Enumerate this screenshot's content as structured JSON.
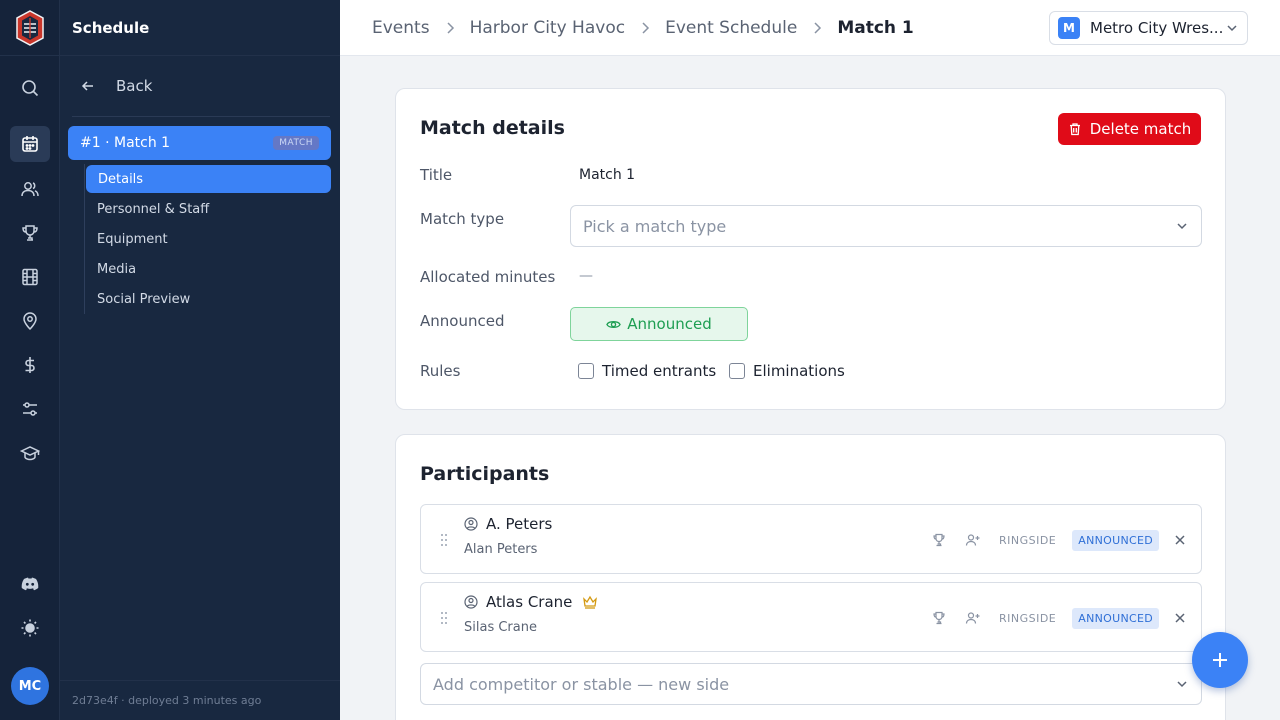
{
  "sidebar": {
    "title": "Schedule",
    "back_label": "Back",
    "match_item": {
      "label": "#1 · Match 1",
      "badge": "MATCH"
    },
    "subnav": [
      {
        "label": "Details",
        "active": true
      },
      {
        "label": "Personnel & Staff",
        "active": false
      },
      {
        "label": "Equipment",
        "active": false
      },
      {
        "label": "Media",
        "active": false
      },
      {
        "label": "Social Preview",
        "active": false
      }
    ],
    "footer": "2d73e4f · deployed 3 minutes ago"
  },
  "rail": {
    "icons": [
      "search-icon",
      "calendar-icon",
      "users-icon",
      "trophy-icon",
      "film-icon",
      "map-pin-icon",
      "dollar-icon",
      "sliders-icon",
      "graduation-cap-icon",
      "discord-icon",
      "sun-icon"
    ],
    "active": "calendar-icon",
    "avatar_initials": "MC"
  },
  "header": {
    "breadcrumb": [
      "Events",
      "Harbor City Havoc",
      "Event Schedule",
      "Match 1"
    ],
    "org": {
      "initial": "M",
      "name": "Metro City Wres..."
    }
  },
  "match_details": {
    "title": "Match details",
    "delete_label": "Delete match",
    "fields": {
      "title_label": "Title",
      "title_value": "Match 1",
      "type_label": "Match type",
      "type_placeholder": "Pick a match type",
      "minutes_label": "Allocated minutes",
      "minutes_value": "—",
      "announced_label": "Announced",
      "announced_button": "Announced",
      "rules_label": "Rules",
      "rule_timed": "Timed entrants",
      "rule_elim": "Eliminations"
    }
  },
  "participants": {
    "title": "Participants",
    "items": [
      {
        "name": "A. Peters",
        "real_name": "Alan Peters",
        "champion": false,
        "ringside": "RINGSIDE",
        "status": "ANNOUNCED"
      },
      {
        "name": "Atlas Crane",
        "real_name": "Silas Crane",
        "champion": true,
        "ringside": "RINGSIDE",
        "status": "ANNOUNCED"
      }
    ],
    "add_placeholder": "Add competitor or stable — new side"
  },
  "colors": {
    "primary": "#3b82f6",
    "danger": "#e00b18",
    "success": "#1e9e52",
    "sidebar_bg": "#182840",
    "rail_bg": "#15233a"
  }
}
